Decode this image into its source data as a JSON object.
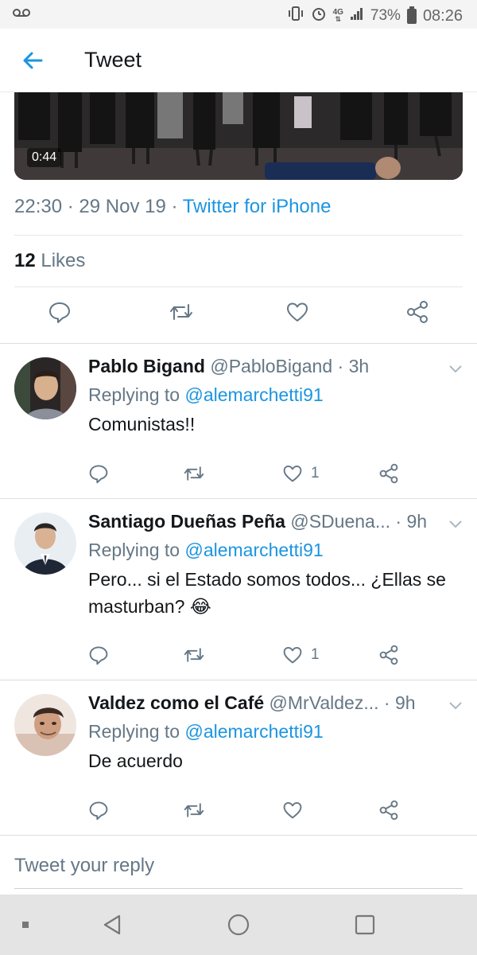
{
  "status_bar": {
    "network": "4G",
    "battery_percent": "73%",
    "time": "08:26"
  },
  "header": {
    "title": "Tweet"
  },
  "video": {
    "duration": "0:44"
  },
  "tweet_meta": {
    "time": "22:30",
    "sep1": "·",
    "date": "29 Nov 19",
    "sep2": "·",
    "client": "Twitter for iPhone"
  },
  "likes": {
    "count": "12",
    "label": "Likes"
  },
  "replies": [
    {
      "name": "Pablo Bigand",
      "handle": "@PabloBigand",
      "sep": "·",
      "time": "3h",
      "replying_prefix": "Replying to",
      "mention": "@alemarchetti91",
      "text": "Comunistas!!",
      "like_count": "1"
    },
    {
      "name": "Santiago Dueñas Peña",
      "handle": "@SDuena...",
      "sep": "·",
      "time": "9h",
      "replying_prefix": "Replying to",
      "mention": "@alemarchetti91",
      "text": "Pero... si el Estado somos todos... ¿Ellas se masturban? 😂",
      "like_count": "1"
    },
    {
      "name": "Valdez como el Café",
      "handle": "@MrValdez...",
      "sep": "·",
      "time": "9h",
      "replying_prefix": "Replying to",
      "mention": "@alemarchetti91",
      "text": "De acuerdo",
      "like_count": ""
    }
  ],
  "compose": {
    "placeholder": "Tweet your reply"
  },
  "colors": {
    "accent": "#1b95e0",
    "secondary_text": "#657786",
    "primary_text": "#14171a",
    "divider": "#e1e8ed"
  },
  "icons": {
    "back": "arrow-left-icon",
    "reply": "speech-bubble-icon",
    "retweet": "retweet-icon",
    "like": "heart-icon",
    "share": "share-icon",
    "more": "chevron-down-icon"
  }
}
